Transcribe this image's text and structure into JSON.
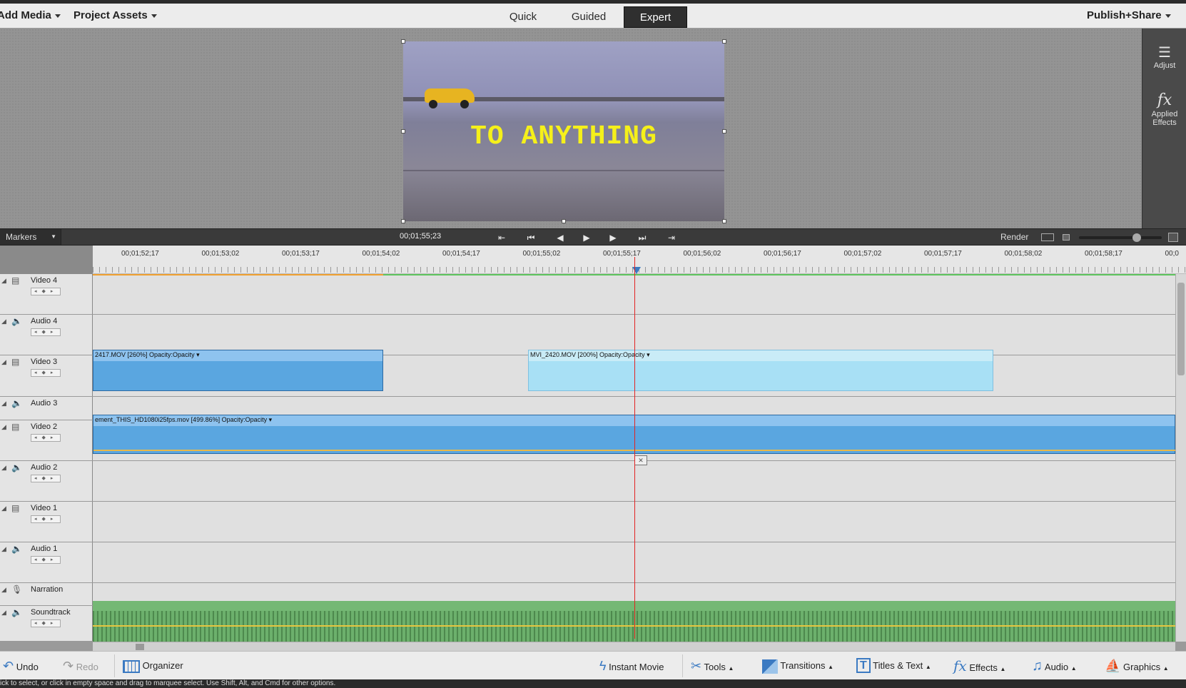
{
  "header": {
    "add_media": "Add Media",
    "project_assets": "Project Assets",
    "modes": [
      "Quick",
      "Guided",
      "Expert"
    ],
    "active_mode": "Expert",
    "publish": "Publish+Share"
  },
  "right_panel": {
    "adjust": "Adjust",
    "applied_effects_1": "Applied",
    "applied_effects_2": "Effects"
  },
  "monitor": {
    "overlay_text": "TO ANYTHING"
  },
  "transport": {
    "markers": "Markers",
    "timecode": "00;01;55;23",
    "render": "Render"
  },
  "ruler": {
    "labels": [
      "00;01;52;17",
      "00;01;53;02",
      "00;01;53;17",
      "00;01;54;02",
      "00;01;54;17",
      "00;01;55;02",
      "00;01;55;17",
      "00;01;56;02",
      "00;01;56;17",
      "00;01;57;02",
      "00;01;57;17",
      "00;01;58;02",
      "00;01;58;17",
      "00;0"
    ]
  },
  "tracks": [
    {
      "name": "Video 4",
      "kind": "video"
    },
    {
      "name": "Audio 4",
      "kind": "audio"
    },
    {
      "name": "Video 3",
      "kind": "video"
    },
    {
      "name": "Audio 3",
      "kind": "audio"
    },
    {
      "name": "Video 2",
      "kind": "video"
    },
    {
      "name": "Audio 2",
      "kind": "audio"
    },
    {
      "name": "Video 1",
      "kind": "video"
    },
    {
      "name": "Audio 1",
      "kind": "audio"
    },
    {
      "name": "Narration",
      "kind": "mic"
    },
    {
      "name": "Soundtrack",
      "kind": "audio"
    }
  ],
  "clips": {
    "v3_a": "2417.MOV [260%]  Opacity:Opacity ▾",
    "v3_b": "MVI_2420.MOV [200%]  Opacity:Opacity ▾",
    "v2": "ement_THIS_HD1080i25fps.mov [499.86%]  Opacity:Opacity ▾"
  },
  "bottom_bar": {
    "undo": "Undo",
    "redo": "Redo",
    "organizer": "Organizer",
    "instant_movie": "Instant Movie",
    "tools": "Tools",
    "transitions": "Transitions",
    "titles_text": "Titles & Text",
    "effects": "Effects",
    "audio": "Audio",
    "graphics": "Graphics"
  },
  "status": "ick to select, or click in empty space and drag to marquee select. Use Shift, Alt, and Cmd for other options."
}
